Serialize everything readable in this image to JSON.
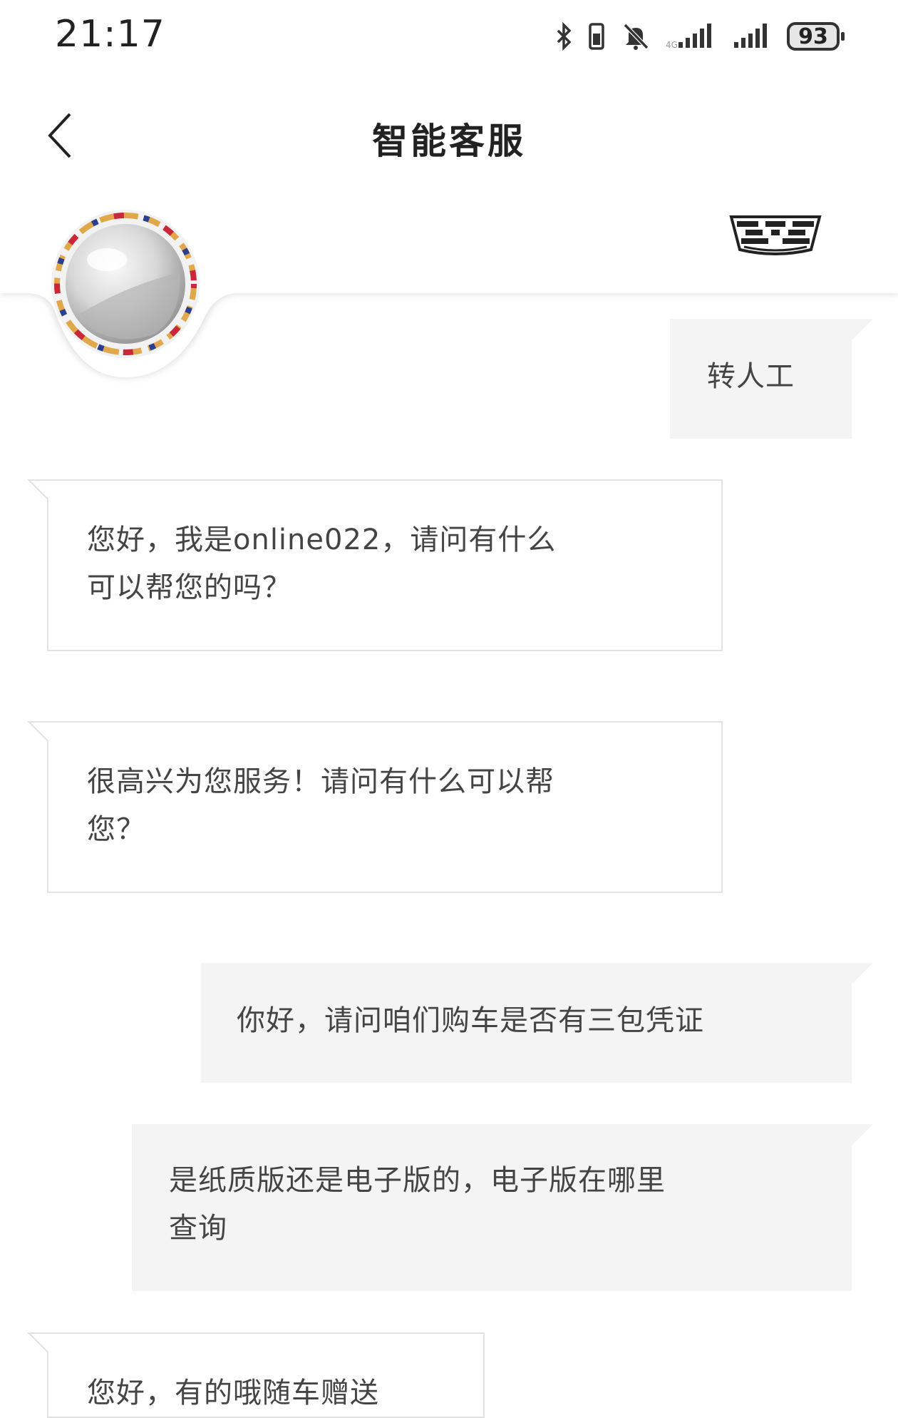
{
  "status_bar": {
    "time": "21:17",
    "battery_level": "93",
    "icons": [
      "bluetooth-icon",
      "vibrate-icon",
      "mute-bell-icon",
      "signal-icon-1",
      "signal-icon-2",
      "battery-icon"
    ]
  },
  "header": {
    "back_icon": "chevron-left-icon",
    "title": "智能客服"
  },
  "brand": {
    "logo": "cadillac-crest-logo",
    "avatar": "support-bot-avatar"
  },
  "messages": [
    {
      "from": "user",
      "text": "转人工"
    },
    {
      "from": "agent",
      "text": "您好，我是online022，请问有什么可以帮您的吗？",
      "lines": [
        "您好，我是online022，请问有什么",
        "可以帮您的吗？"
      ]
    },
    {
      "from": "agent",
      "text": "很高兴为您服务！请问有什么可以帮您？",
      "lines": [
        "很高兴为您服务！请问有什么可以帮",
        "您？"
      ]
    },
    {
      "from": "user",
      "text": "你好，请问咱们购车是否有三包凭证"
    },
    {
      "from": "user",
      "text": "是纸质版还是电子版的，电子版在哪里查询",
      "lines": [
        "是纸质版还是电子版的，电子版在哪里",
        "查询"
      ]
    },
    {
      "from": "agent",
      "text": "您好，有的哦随车赠送"
    }
  ],
  "colors": {
    "agent_bubble_bg": "#ffffff",
    "agent_bubble_border": "#e2e2e2",
    "user_bubble_bg": "#f4f4f4",
    "text": "#444444"
  }
}
